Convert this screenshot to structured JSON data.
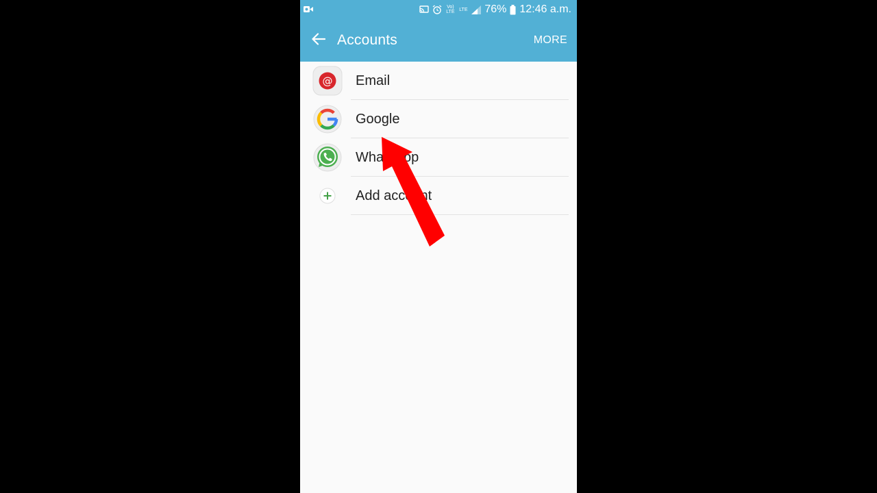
{
  "status_bar": {
    "battery": "76%",
    "time": "12:46 a.m.",
    "network_volte": "Vo) LTE",
    "network_lte": "LTE",
    "icons": [
      "video-record-icon",
      "cast-icon",
      "alarm-icon",
      "signal-icon",
      "battery-icon"
    ]
  },
  "app_bar": {
    "title": "Accounts",
    "more_label": "MORE",
    "back_icon": "arrow-left-icon"
  },
  "accounts": {
    "items": [
      {
        "label": "Email",
        "icon": "email-app-icon"
      },
      {
        "label": "Google",
        "icon": "google-icon"
      },
      {
        "label": "WhatsApp",
        "icon": "whatsapp-icon"
      },
      {
        "label": "Add account",
        "icon": "plus-icon"
      }
    ]
  },
  "colors": {
    "header": "#52b0d5",
    "background": "#fafafa",
    "annotation_arrow": "#ff0000"
  }
}
